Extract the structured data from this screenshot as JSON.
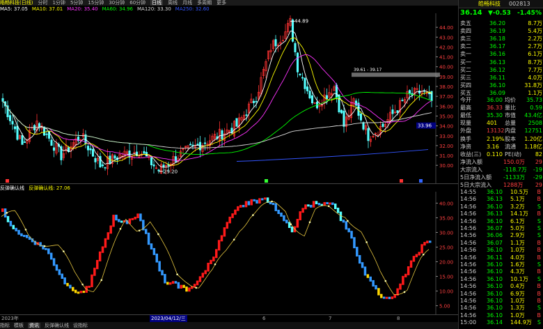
{
  "top_menu": {
    "title": "皓畅科技(日线)",
    "items": [
      "分时",
      "1分钟",
      "5分钟",
      "15分钟",
      "30分钟",
      "60分钟",
      "日线",
      "周线",
      "月线",
      "多周期",
      "更多"
    ],
    "active_index": 6
  },
  "ma_legend": [
    {
      "label": "MA5: 37.05",
      "color": "#ffffff"
    },
    {
      "label": "MA10: 37.01",
      "color": "#ffff00"
    },
    {
      "label": "MA20: 35.40",
      "color": "#ff33ff"
    },
    {
      "label": "MA60: 34.96",
      "color": "#00ff00"
    },
    {
      "label": "MA120: 33.30",
      "color": "#dddddd"
    },
    {
      "label": "MA250: 32.60",
      "color": "#3355ff"
    }
  ],
  "price_axis": {
    "ticks": [
      "44.00",
      "43.00",
      "42.00",
      "41.00",
      "40.00",
      "39.00",
      "38.00",
      "37.00",
      "36.00",
      "35.00",
      "34.00",
      "33.00",
      "32.00",
      "31.00",
      "30.00"
    ]
  },
  "annotations": {
    "high": "44.89",
    "low": "29.20",
    "range": "39.61 - 39.17",
    "cursor_price": "33.96"
  },
  "indicator": {
    "name": "反弹确认线",
    "value_label": "反弹确认线: 27.06",
    "ticks": [
      "40.00",
      "35.00",
      "30.00",
      "25.00",
      "20.00",
      "15.00",
      "10.00",
      "5.00"
    ]
  },
  "date_labels": {
    "start": "2023年",
    "cursor": "2023/04/12/三",
    "m6": "6",
    "m7": "7",
    "m8": "8"
  },
  "bottom_tabs": [
    "指标",
    "模板",
    "资讯",
    "反弹确认线",
    "设指标"
  ],
  "quote": {
    "name": "皓畅科技",
    "code": "002813",
    "price": "36.14",
    "change": "▼-0.53",
    "pct": "-1.45%",
    "sell": [
      [
        "卖五",
        "36.20",
        "8.7万"
      ],
      [
        "卖四",
        "36.19",
        "5.4万"
      ],
      [
        "卖三",
        "36.18",
        "2.2万"
      ],
      [
        "卖二",
        "36.17",
        "2.7万"
      ],
      [
        "卖一",
        "36.16",
        "6.1万"
      ]
    ],
    "buy": [
      [
        "买一",
        "36.13",
        "8.7万"
      ],
      [
        "买二",
        "36.12",
        "7.7万"
      ],
      [
        "买三",
        "36.11",
        "4.0万"
      ],
      [
        "买四",
        "36.10",
        "31.8万"
      ],
      [
        "买五",
        "36.09",
        "1.1万"
      ]
    ],
    "stats": [
      [
        "今开",
        "36.00",
        "均价",
        "35.73"
      ],
      [
        "最高",
        "36.33",
        "量比",
        "0.59"
      ],
      [
        "最低",
        "35.30",
        "市值",
        "43.4亿"
      ],
      [
        "现量",
        "401",
        "总量",
        "2508"
      ],
      [
        "外盘",
        "13132",
        "内盘",
        "12751"
      ]
    ],
    "stats2": [
      [
        "换手",
        "2.19%",
        "股本",
        "1.20亿"
      ],
      [
        "净资",
        "3.16",
        "流通",
        "1.18亿"
      ],
      [
        "收益(三)",
        "0.110",
        "PE(动)",
        "82"
      ]
    ],
    "flows": [
      [
        "净流入额",
        "150.0万",
        "29"
      ],
      [
        "大宗流入",
        "-118.7万",
        "-19"
      ],
      [
        "5日净流入额",
        "-1133万",
        "-29"
      ],
      [
        "5日大宗流入",
        "1288万",
        "29"
      ]
    ],
    "ticks": [
      [
        "14:55",
        "36.10",
        "10.5万",
        "B"
      ],
      [
        "14:56",
        "36.13",
        "5.1万",
        "B"
      ],
      [
        "14:56",
        "36.10",
        "3.2万",
        "S"
      ],
      [
        "14:56",
        "36.13",
        "14.1万",
        "B"
      ],
      [
        "14:56",
        "36.10",
        "6.1万",
        "S"
      ],
      [
        "14:56",
        "36.07",
        "5.0万",
        "S"
      ],
      [
        "14:56",
        "36.06",
        "2.9万",
        "S"
      ],
      [
        "14:56",
        "36.07",
        "1.1万",
        "B"
      ],
      [
        "14:56",
        "36.10",
        "1.0万",
        "B"
      ],
      [
        "14:56",
        "36.11",
        "4.0万",
        "B"
      ],
      [
        "14:56",
        "36.10",
        "1.6万",
        "S"
      ],
      [
        "14:56",
        "36.10",
        "4.3万",
        "B"
      ],
      [
        "14:56",
        "36.10",
        "10.1万",
        "S"
      ],
      [
        "14:56",
        "36.10",
        "0.4万",
        "B"
      ],
      [
        "14:56",
        "36.10",
        "6.9万",
        "B"
      ],
      [
        "14:56",
        "36.10",
        "1.0万",
        "B"
      ],
      [
        "14:56",
        "36.10",
        "1.3万",
        "S"
      ],
      [
        "14:56",
        "36.10",
        "1.0万",
        "B"
      ],
      [
        "15:00",
        "36.14",
        "144.9万",
        "S"
      ]
    ]
  }
}
